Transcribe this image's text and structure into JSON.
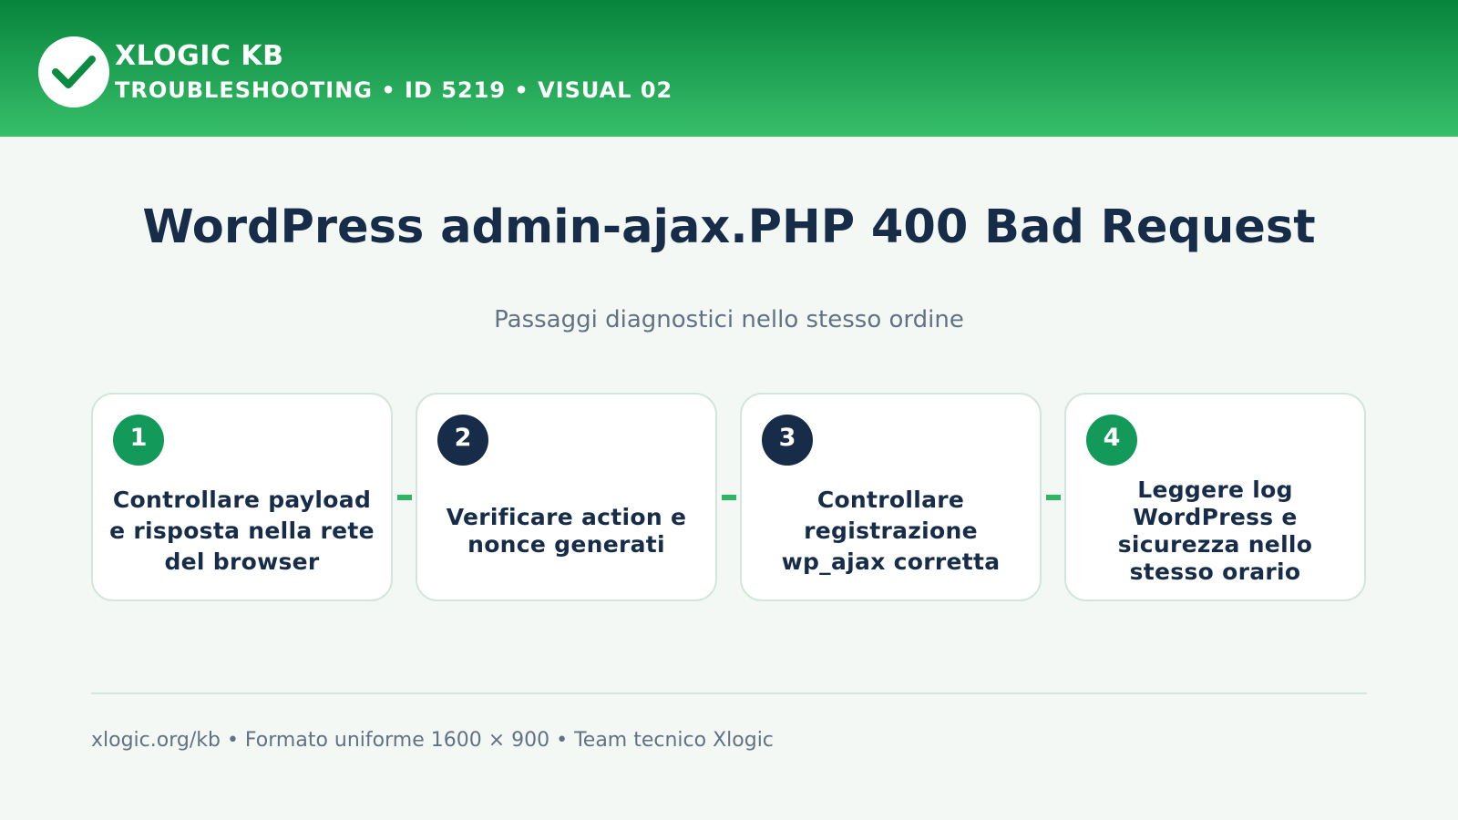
{
  "header": {
    "logo_icon": "checkmark-icon",
    "brand": "XLOGIC KB",
    "meta": "TROUBLESHOOTING • ID 5219 • VISUAL 02",
    "colors": {
      "gradient_top": "#07843c",
      "gradient_bottom": "#37bf6a"
    }
  },
  "main": {
    "title": "WordPress admin-ajax.PHP 400 Bad Request",
    "subtitle": "Passaggi diagnostici nello stesso ordine",
    "steps": [
      {
        "number": "1",
        "text": "Controllare payload e risposta nella rete del browser",
        "badge_color": "#13995a"
      },
      {
        "number": "2",
        "text": "Verificare action e nonce generati",
        "badge_color": "#172c48"
      },
      {
        "number": "3",
        "text": "Controllare registrazione wp_ajax corretta",
        "badge_color": "#172c48"
      },
      {
        "number": "4",
        "text": "Leggere log WordPress e sicurezza nello stesso orario",
        "badge_color": "#13995a"
      }
    ]
  },
  "footer": {
    "text": "xlogic.org/kb • Formato uniforme 1600 × 900 • Team tecnico Xlogic"
  },
  "colors": {
    "background": "#f3f8f5",
    "title": "#172c48",
    "muted": "#637184",
    "accent": "#2fb566"
  }
}
